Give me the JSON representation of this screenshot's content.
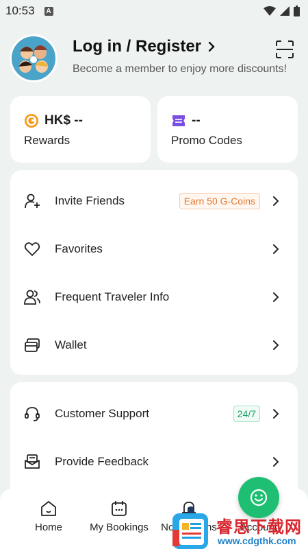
{
  "status_bar": {
    "time": "10:53",
    "keyboard_badge": "A"
  },
  "profile": {
    "title": "Log in / Register",
    "subtitle": "Become a member to enjoy more discounts!"
  },
  "rewards": {
    "amount": "HK$ --",
    "label": "Rewards"
  },
  "promo": {
    "amount": "--",
    "label": "Promo Codes"
  },
  "menu1": {
    "items": [
      {
        "label": "Invite Friends",
        "badge": "Earn 50 G-Coins"
      },
      {
        "label": "Favorites"
      },
      {
        "label": "Frequent Traveler Info"
      },
      {
        "label": "Wallet"
      }
    ]
  },
  "menu2": {
    "items": [
      {
        "label": "Customer Support",
        "badge": "24/7"
      },
      {
        "label": "Provide Feedback"
      }
    ]
  },
  "tabs": [
    {
      "label": "Home"
    },
    {
      "label": "My Bookings"
    },
    {
      "label": "Notifications"
    },
    {
      "label": "Account"
    }
  ],
  "watermark": {
    "cn_text": "睿思下载网",
    "url": "www.cdgthk.com"
  },
  "colors": {
    "accent": "#1fbf73",
    "orange": "#e07a31",
    "purple": "#7b4fe0",
    "background": "#eef3f1"
  }
}
